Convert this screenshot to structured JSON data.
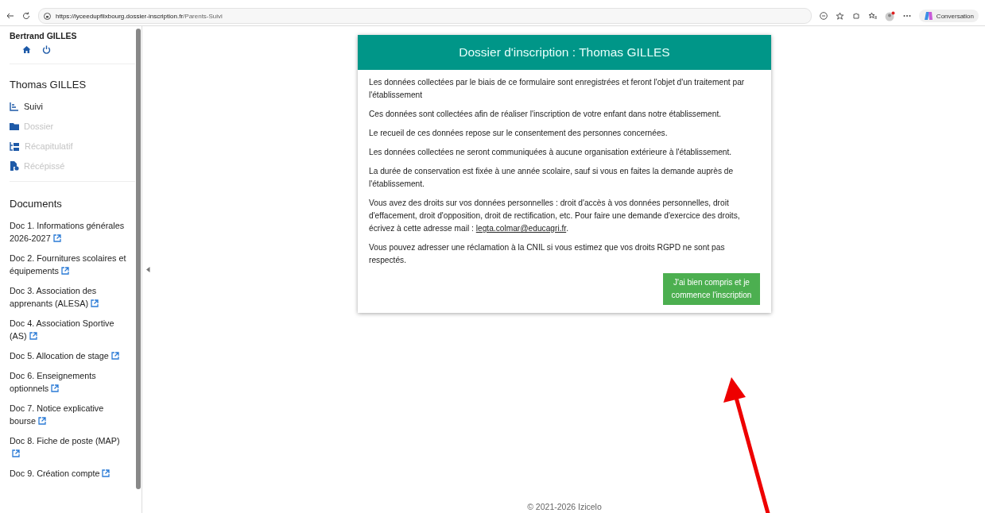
{
  "browser": {
    "url_host": "https://lyceedupflixbourg.dossier-inscription.fr",
    "url_path": "/Parents-Suivi",
    "copilot_label": "Conversation"
  },
  "sidebar": {
    "user": "Bertrand GILLES",
    "student": "Thomas GILLES",
    "nav": [
      {
        "kind": "suivi",
        "label": "Suivi",
        "disabled": false
      },
      {
        "kind": "dossier",
        "label": "Dossier",
        "disabled": true
      },
      {
        "kind": "recap",
        "label": "Récapitulatif",
        "disabled": true
      },
      {
        "kind": "recepisse",
        "label": "Récépissé",
        "disabled": true
      }
    ],
    "documents_title": "Documents",
    "documents": [
      "Doc 1. Informations générales 2026-2027",
      "Doc 2. Fournitures scolaires et équipements",
      "Doc 3. Association des apprenants (ALESA)",
      "Doc 4. Association Sportive (AS)",
      "Doc 5. Allocation de stage",
      "Doc 6. Enseignements optionnels",
      "Doc 7. Notice explicative bourse",
      "Doc 8. Fiche de poste (MAP)",
      "Doc 9. Création compte"
    ]
  },
  "card": {
    "title": "Dossier d'inscription : Thomas GILLES",
    "paragraphs": [
      {
        "text": "Les données collectées par le biais de ce formulaire sont enregistrées et feront l'objet d'un traitement par l'établissement"
      },
      {
        "text": "Ces données sont collectées afin de réaliser l'inscription de votre enfant dans notre établissement."
      },
      {
        "text": "Le recueil de ces données repose sur le consentement des personnes concernées."
      },
      {
        "text": "Les données collectées ne seront communiquées à aucune organisation extérieure à l'établissement."
      },
      {
        "text": "La durée de conservation est fixée à une année scolaire, sauf si vous en faites la demande auprès de l'établissement."
      },
      {
        "text": "Vous avez des droits sur vos données personnelles : droit d'accès à vos données personnelles, droit d'effacement, droit d'opposition, droit de rectification, etc. Pour faire une demande d'exercice des droits, écrivez à cette adresse mail : ",
        "link": "legta.colmar@educagri.fr",
        "after": "."
      },
      {
        "text": "Vous pouvez adresser une réclamation à la CNIL si vous estimez que vos droits RGPD ne sont pas respectés."
      }
    ],
    "button": "J'ai bien compris et je commence l'inscription"
  },
  "footer": "© 2021-2026 Izicelo"
}
